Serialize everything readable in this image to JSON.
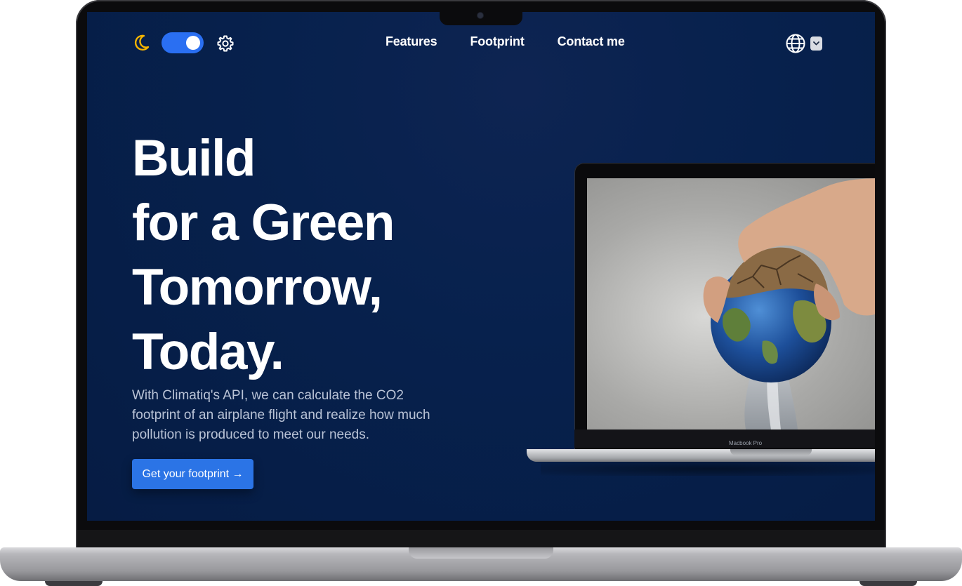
{
  "nav": {
    "links": [
      "Features",
      "Footprint",
      "Contact me"
    ]
  },
  "hero": {
    "headline": [
      "Build",
      "for a Green",
      "Tomorrow,",
      "Today."
    ],
    "description": "With Climatiq's API, we can calculate the CO2 footprint of an airplane flight and realize how much pollution is produced to meet our needs.",
    "cta_label": "Get your footprint →"
  },
  "device": {
    "label": "Macbook Pro"
  },
  "theme": {
    "dark_mode_on": true,
    "accent": "#2a6ff2",
    "background": "#061c44",
    "moon_color": "#f5b400"
  },
  "icons": [
    "moon-icon",
    "gear-icon",
    "globe-icon",
    "chevron-down-icon",
    "arrow-right-icon"
  ]
}
